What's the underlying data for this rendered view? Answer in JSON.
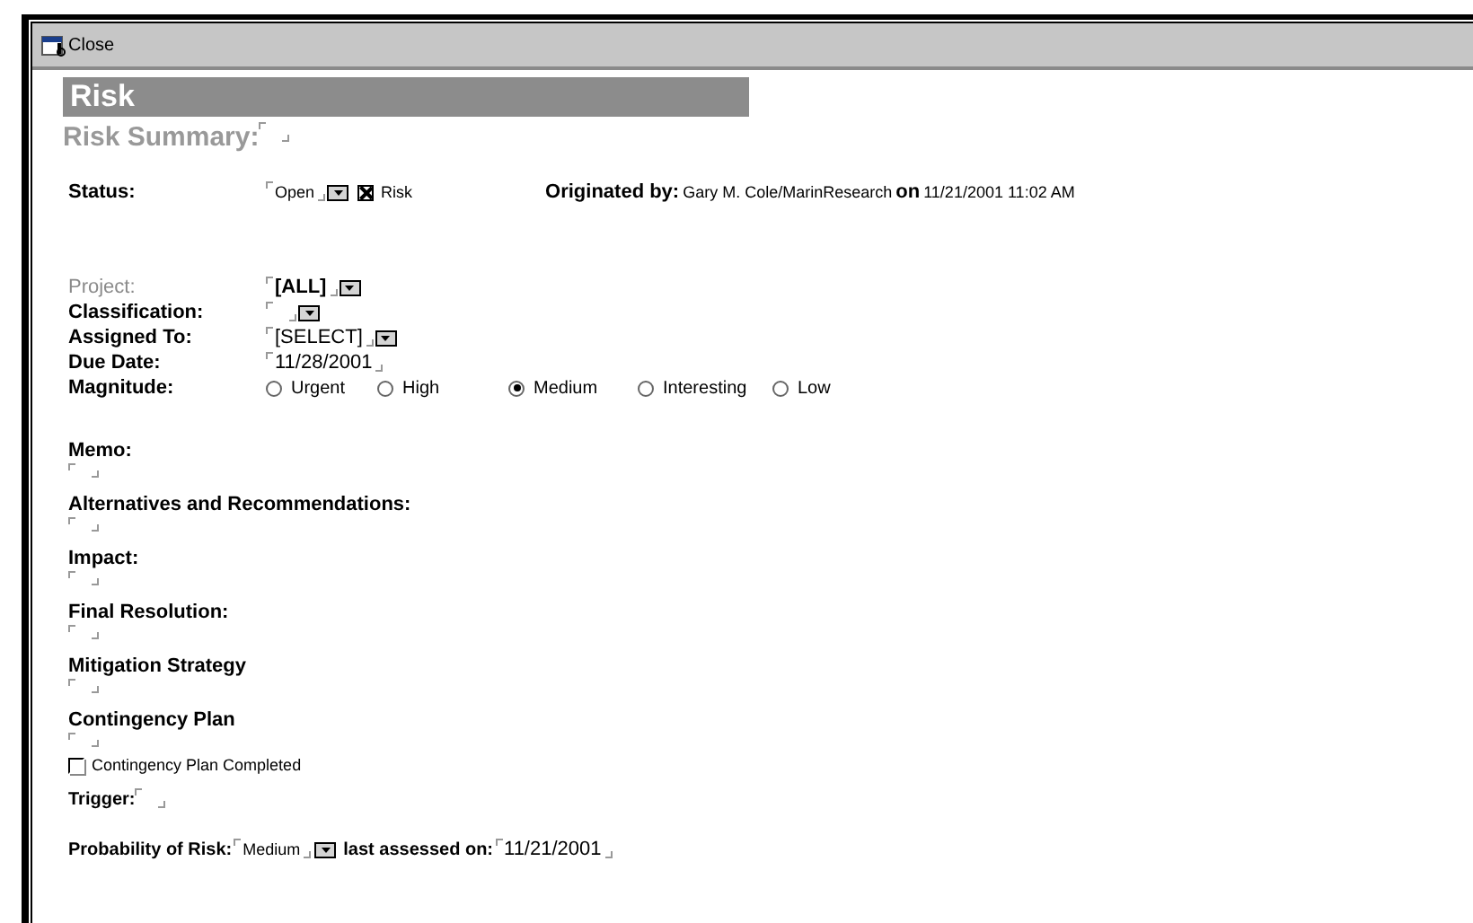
{
  "toolbar": {
    "close_button": "Close"
  },
  "form": {
    "title": "Risk",
    "summary_label": "Risk Summary:",
    "status": {
      "label": "Status:",
      "value": "Open",
      "risk_checkbox": {
        "label": "Risk",
        "checked": true
      }
    },
    "originated": {
      "label": "Originated by:",
      "name": "Gary M. Cole/MarinResearch",
      "on_label": "on",
      "datetime": "11/21/2001 11:02 AM"
    },
    "fields": [
      {
        "label": "Project:",
        "value": "[ALL]",
        "kind": "dropdown",
        "dimmed": true,
        "emphasized": true
      },
      {
        "label": "Classification:",
        "kind": "dropdown",
        "dimmed": false
      },
      {
        "label": "Assigned To:",
        "value": "[SELECT]",
        "kind": "dropdown",
        "dimmed": false,
        "emphasized": false
      },
      {
        "label": "Due Date:",
        "value": "11/28/2001",
        "kind": "text",
        "dimmed": false,
        "emphasized": false
      }
    ],
    "magnitude": {
      "label": "Magnitude:",
      "options": [
        {
          "label": "Urgent",
          "selected": false
        },
        {
          "label": "High",
          "selected": false
        },
        {
          "label": "Medium",
          "selected": true
        },
        {
          "label": "Interesting",
          "selected": false
        },
        {
          "label": "Low",
          "selected": false
        }
      ]
    },
    "sections": [
      "Memo:",
      "Alternatives and Recommendations:",
      "Impact:",
      "Final Resolution:",
      "Mitigation Strategy",
      "Contingency Plan"
    ],
    "completed_checkbox": {
      "label": "Contingency Plan Completed",
      "checked": false
    },
    "trigger": {
      "label": "Trigger:"
    },
    "probability": {
      "label": "Probability of Risk:",
      "value": "Medium",
      "assessed_label": "last assessed on:",
      "assessed_date": "11/21/2001"
    }
  }
}
